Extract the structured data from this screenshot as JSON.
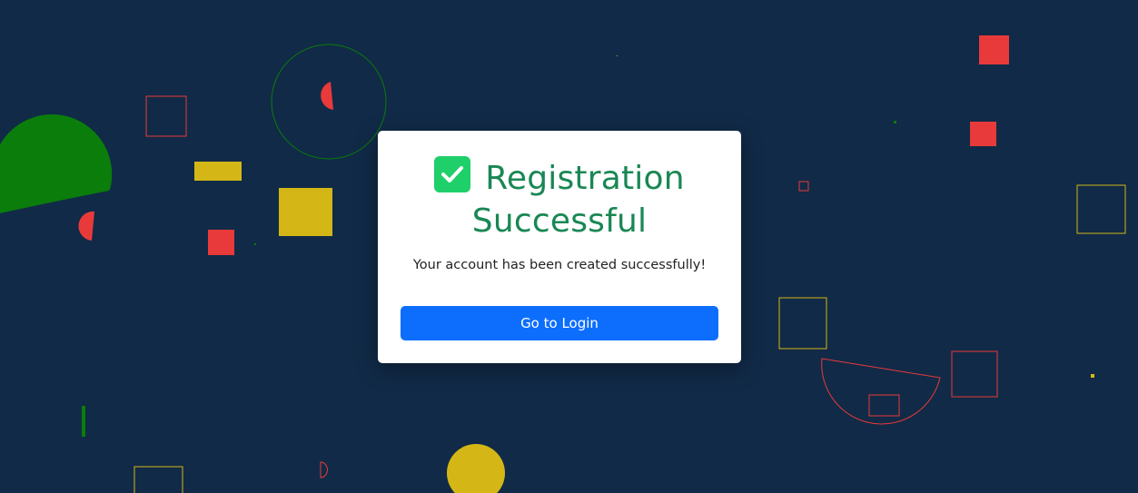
{
  "dialog": {
    "title": "Registration Successful",
    "message": "Your account has been created successfully!",
    "button_label": "Go to Login",
    "icon": "check-box-icon"
  },
  "colors": {
    "background": "#112a47",
    "title": "#198754",
    "button": "#0d6efd",
    "check_icon": "#1fcf6a",
    "shape_red": "#e83a3a",
    "shape_yellow": "#d4b716",
    "shape_green": "#0a7d0a"
  }
}
